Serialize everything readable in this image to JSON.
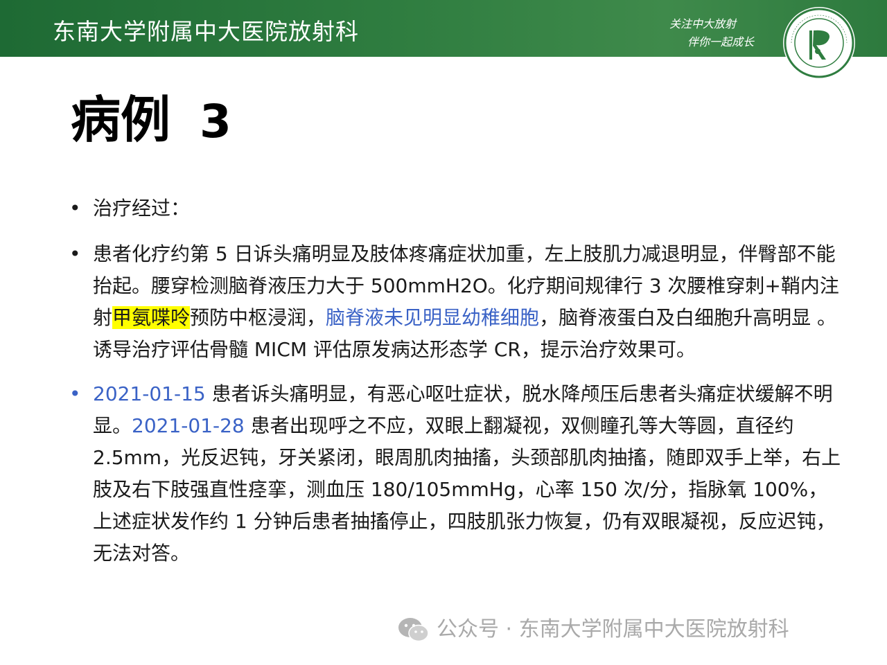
{
  "header": {
    "title": "东南大学附属中大医院放射科",
    "slogan_line1": "关注中大放射",
    "slogan_line2": "伴你一起成长",
    "logo_icon": "radiology-department-logo",
    "colors": {
      "header_green": "#2f7d40",
      "accent_blue": "#3a62c6",
      "highlight": "#ffff00"
    }
  },
  "slide": {
    "title": "病例",
    "title_number": "3"
  },
  "bullets": {
    "b1": {
      "text": "治疗经过："
    },
    "b2": {
      "part1": "患者化疗约第 5 日诉头痛明显及肢体疼痛症状加重，左上肢肌力减退明显，伴臀部不能抬起。腰穿检测脑脊液压力大于 500mmH2O。化疗期间规律行 3 次腰椎穿刺+鞘内注射",
      "highlight": "甲氨喋呤",
      "part2": "预防中枢浸润，",
      "blue": "脑脊液未见明显幼稚细胞",
      "part3": "，脑脊液蛋白及白细胞升高明显 。诱导治疗评估骨髓 MICM 评估原发病达形态学 CR，提示治疗效果可。"
    },
    "b3": {
      "date1": "2021-01-15",
      "part1": " 患者诉头痛明显，有恶心呕吐症状，脱水降颅压后患者头痛症状缓解不明显。",
      "date2": "2021-01-28",
      "part2": " 患者出现呼之不应，双眼上翻凝视，双侧瞳孔等大等圆，直径约 2.5mm，光反迟钝，牙关紧闭，眼周肌肉抽搐，头颈部肌肉抽搐，随即双手上举，右上肢及右下肢强直性痉挛，测血压 180/105mmHg，心率 150 次/分，指脉氧 100%，上述症状发作约 1 分钟后患者抽搐停止，四肢肌张力恢复，仍有双眼凝视，反应迟钝，无法对答。"
    }
  },
  "watermark": {
    "icon": "wechat-icon",
    "text": "公众号 · 东南大学附属中大医院放射科"
  }
}
